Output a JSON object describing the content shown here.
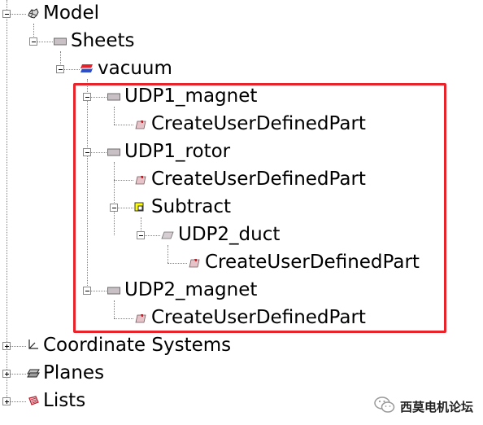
{
  "tree": {
    "model": {
      "label": "Model",
      "icon": "model-icon"
    },
    "sheets": {
      "label": "Sheets",
      "icon": "sheet-folder-icon"
    },
    "vacuum": {
      "label": "vacuum",
      "icon": "material-icon"
    },
    "udp1_magnet": {
      "label": "UDP1_magnet",
      "icon": "sheet-folder-icon",
      "children": [
        {
          "label": "CreateUserDefinedPart",
          "icon": "create-part-icon"
        }
      ]
    },
    "udp1_rotor": {
      "label": "UDP1_rotor",
      "icon": "sheet-folder-icon",
      "children": [
        {
          "label": "CreateUserDefinedPart",
          "icon": "create-part-icon"
        },
        {
          "label": "Subtract",
          "icon": "subtract-icon"
        }
      ]
    },
    "udp2_duct": {
      "label": "UDP2_duct",
      "icon": "sheet-part-icon",
      "children": [
        {
          "label": "CreateUserDefinedPart",
          "icon": "create-part-icon"
        }
      ]
    },
    "udp2_magnet": {
      "label": "UDP2_magnet",
      "icon": "sheet-folder-icon",
      "children": [
        {
          "label": "CreateUserDefinedPart",
          "icon": "create-part-icon"
        }
      ]
    },
    "coordinate_systems": {
      "label": "Coordinate Systems",
      "icon": "axis-icon"
    },
    "planes": {
      "label": "Planes",
      "icon": "planes-icon"
    },
    "lists": {
      "label": "Lists",
      "icon": "lists-icon"
    }
  },
  "watermark": {
    "text": "西莫电机论坛",
    "icon": "wechat-icon"
  },
  "colors": {
    "highlight": "#e8232a",
    "connector": "#808080"
  }
}
